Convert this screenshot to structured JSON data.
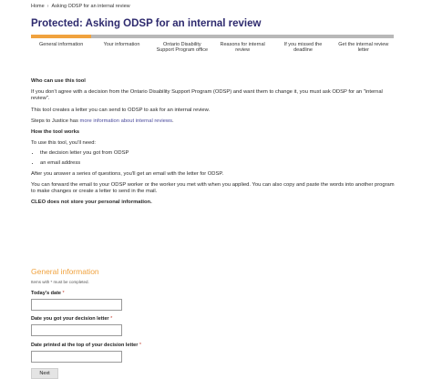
{
  "breadcrumb": {
    "home": "Home",
    "separator": "›",
    "current": "Asking ODSP for an internal review"
  },
  "page_title": "Protected: Asking ODSP for an internal review",
  "progress": {
    "fraction": 0.1667,
    "color": "#f0a23e"
  },
  "steps": [
    "General information",
    "Your information",
    "Ontario Disability Support Program office",
    "Reasons for internal review",
    "If you missed the deadline",
    "Get the internal review letter"
  ],
  "content": {
    "who_heading": "Who can use this tool",
    "p1": "If you don't agree with a decision from the Ontario Disability Support Program (ODSP) and want them to change it, you must ask ODSP for an \"internal review\".",
    "p2": "This tool creates a letter you can send to ODSP to ask for an internal review.",
    "p3_prefix": "Steps to Justice has ",
    "p3_link": "more information about internal reviews",
    "p3_suffix": ".",
    "how_heading": "How the tool works",
    "p4": "To use this tool, you'll need:",
    "needs": [
      "the decision letter you got from ODSP",
      "an email address"
    ],
    "p5": "After you answer a series of questions, you'll get an email with the letter for ODSP.",
    "p6": "You can forward the email to your ODSP worker or the worker you met with when you applied. You can also copy and paste the words into another program to make changes or create a letter to send in the mail.",
    "p7": "CLEO does not store your personal information."
  },
  "form": {
    "section_title": "General information",
    "required_note": "Items with * must be completed.",
    "fields": [
      {
        "label": "Today's date",
        "required_mark": "*",
        "value": ""
      },
      {
        "label": "Date you got your decision letter",
        "required_mark": "*",
        "value": ""
      },
      {
        "label": "Date printed at the top of your decision letter",
        "required_mark": "*",
        "value": ""
      }
    ],
    "next_label": "Next"
  }
}
